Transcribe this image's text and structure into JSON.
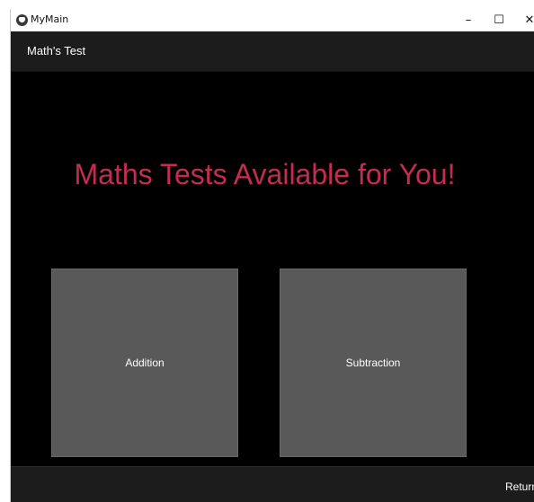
{
  "window": {
    "title": "MyMain",
    "controls": {
      "minimize": "–",
      "maximize": "☐",
      "close": "✕"
    }
  },
  "appbar": {
    "title": "Math's Test"
  },
  "main": {
    "headline": "Maths Tests Available for You!",
    "tests": [
      {
        "label": "Addition"
      },
      {
        "label": "Subtraction"
      }
    ]
  },
  "footer": {
    "return_label": "Return"
  },
  "colors": {
    "headline": "#c52c52",
    "card": "#595959",
    "bar": "#1c1c1c",
    "background": "#000000"
  },
  "icons": {
    "app": "app-logo-icon"
  }
}
